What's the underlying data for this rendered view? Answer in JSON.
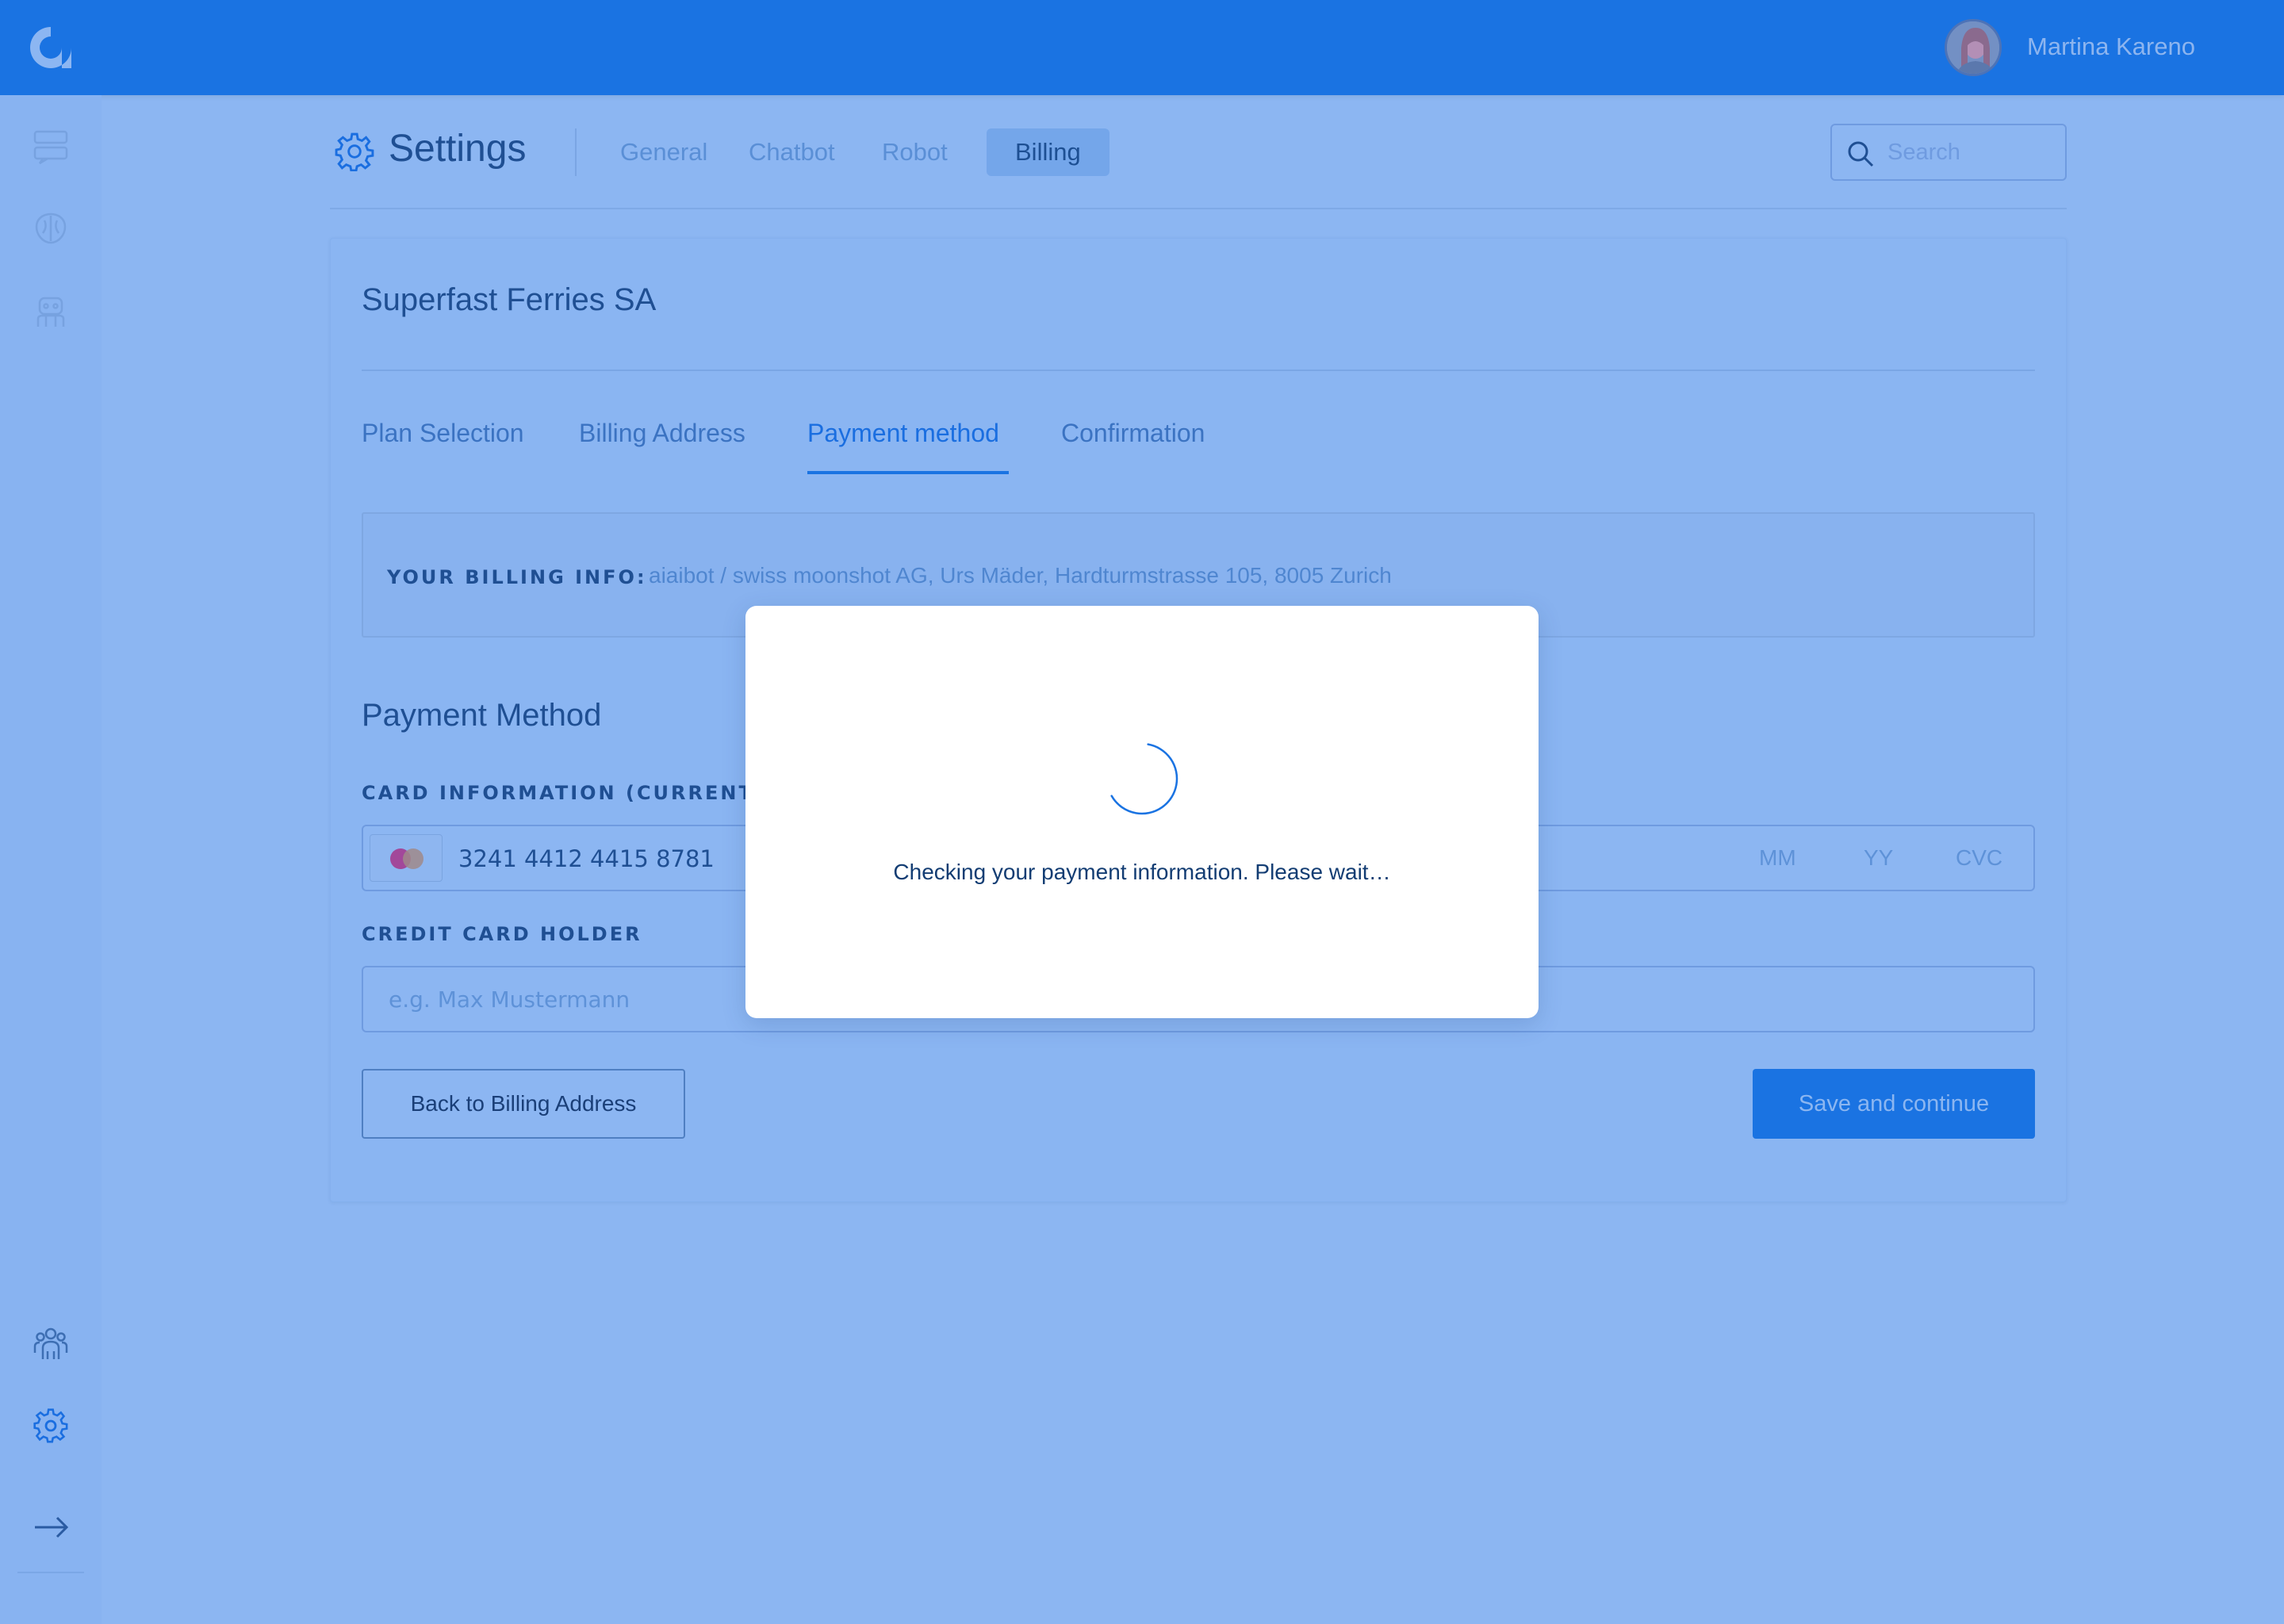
{
  "topbar": {
    "logo_icon": "aiaibot-logo-icon",
    "user_name": "Martina Kareno"
  },
  "sidebar": {
    "items": [
      {
        "icon": "chat-flow-icon"
      },
      {
        "icon": "brain-icon"
      },
      {
        "icon": "robot-icon"
      },
      {
        "icon": "team-icon"
      },
      {
        "icon": "gear-icon"
      },
      {
        "icon": "arrow-right-icon"
      }
    ]
  },
  "header": {
    "title": "Settings",
    "tabs": [
      {
        "label": "General"
      },
      {
        "label": "Chatbot"
      },
      {
        "label": "Robot"
      },
      {
        "label": "Billing",
        "active": true
      }
    ],
    "search_placeholder": "Search"
  },
  "card": {
    "company": "Superfast Ferries SA",
    "steps": [
      {
        "label": "Plan Selection"
      },
      {
        "label": "Billing Address"
      },
      {
        "label": "Payment method",
        "active": true
      },
      {
        "label": "Confirmation"
      }
    ],
    "billing_info_label": "YOUR BILLING INFO:",
    "billing_info_value": "aiaibot / swiss moonshot AG,  Urs Mäder,  Hardturmstrasse 105,  8005 Zurich",
    "payment_title": "Payment Method",
    "card_label": "CARD INFORMATION (CURRENTLY C",
    "card_number": "3241 4412 4415 8781",
    "card_mm": "MM",
    "card_yy": "YY",
    "card_cvc": "CVC",
    "holder_label": "CREDIT CARD HOLDER",
    "holder_placeholder": "e.g. Max Mustermann",
    "back_button": "Back to Billing Address",
    "save_button": "Save and continue"
  },
  "modal": {
    "message": "Checking your payment information. Please wait…"
  },
  "colors": {
    "accent": "#1a73e2",
    "overlay_bg": "#8cb6f2",
    "text_dark": "#1f4f93",
    "modal_bg": "#ffffff"
  }
}
